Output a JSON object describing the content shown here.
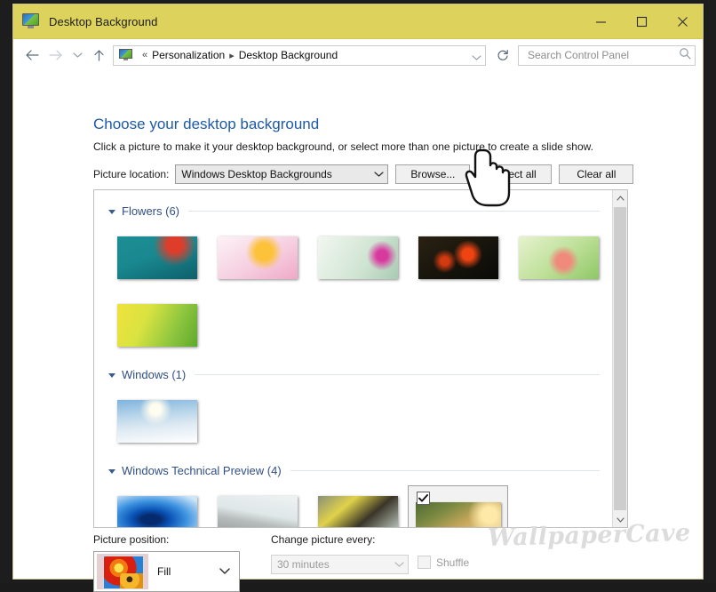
{
  "window": {
    "title": "Desktop Background",
    "titlebar_color": "#ddd35c",
    "icon": "display-monitor-icon",
    "minimize_label": "Minimize",
    "maximize_label": "Maximize",
    "close_label": "Close"
  },
  "navigation": {
    "back_label": "Back",
    "forward_label": "Forward",
    "recent_label": "Recent locations",
    "up_label": "Up",
    "refresh_label": "Refresh",
    "breadcrumb_overflow": "«",
    "breadcrumb": [
      "Personalization",
      "Desktop Background"
    ],
    "breadcrumb_separator": "▸"
  },
  "search": {
    "placeholder": "Search Control Panel",
    "value": "",
    "icon": "search-icon"
  },
  "main": {
    "heading": "Choose your desktop background",
    "subheading": "Click a picture to make it your desktop background, or select more than one picture to create a slide show.",
    "heading_color": "#1e5aa8"
  },
  "picture_location": {
    "label": "Picture location:",
    "value": "Windows Desktop Backgrounds",
    "browse_label": "Browse...",
    "select_all_label": "Select all",
    "clear_all_label": "Clear all"
  },
  "groups": [
    {
      "name": "Flowers (6)",
      "expanded": true,
      "items": [
        {
          "name": "teal-red-flower",
          "selected": false
        },
        {
          "name": "pink-yellow-daisy",
          "selected": false
        },
        {
          "name": "pale-green-magenta-flower",
          "selected": false
        },
        {
          "name": "dark-red-tulips",
          "selected": false
        },
        {
          "name": "green-pink-lily",
          "selected": false
        },
        {
          "name": "yellow-green-leaves",
          "selected": false
        }
      ]
    },
    {
      "name": "Windows (1)",
      "expanded": true,
      "items": [
        {
          "name": "snow-mountain-sunrise",
          "selected": false
        }
      ]
    },
    {
      "name": "Windows Technical Preview (4)",
      "expanded": true,
      "items": [
        {
          "name": "blue-abstract-wave",
          "selected": false
        },
        {
          "name": "grey-concrete-seawall",
          "selected": false
        },
        {
          "name": "yellow-black-abstract",
          "selected": false
        },
        {
          "name": "coastal-sunset-cliff",
          "selected": true
        }
      ]
    }
  ],
  "picture_position": {
    "label": "Picture position:",
    "value": "Fill",
    "preview_icon": "flower-thumbnail"
  },
  "change_picture": {
    "label": "Change picture every:",
    "value": "30 minutes",
    "disabled": true
  },
  "shuffle": {
    "label": "Shuffle",
    "checked": false,
    "disabled": true
  },
  "watermark": {
    "text": "WallpaperCave"
  },
  "cursor": {
    "type": "hand-pointer-cursor",
    "over": "Browse..."
  }
}
